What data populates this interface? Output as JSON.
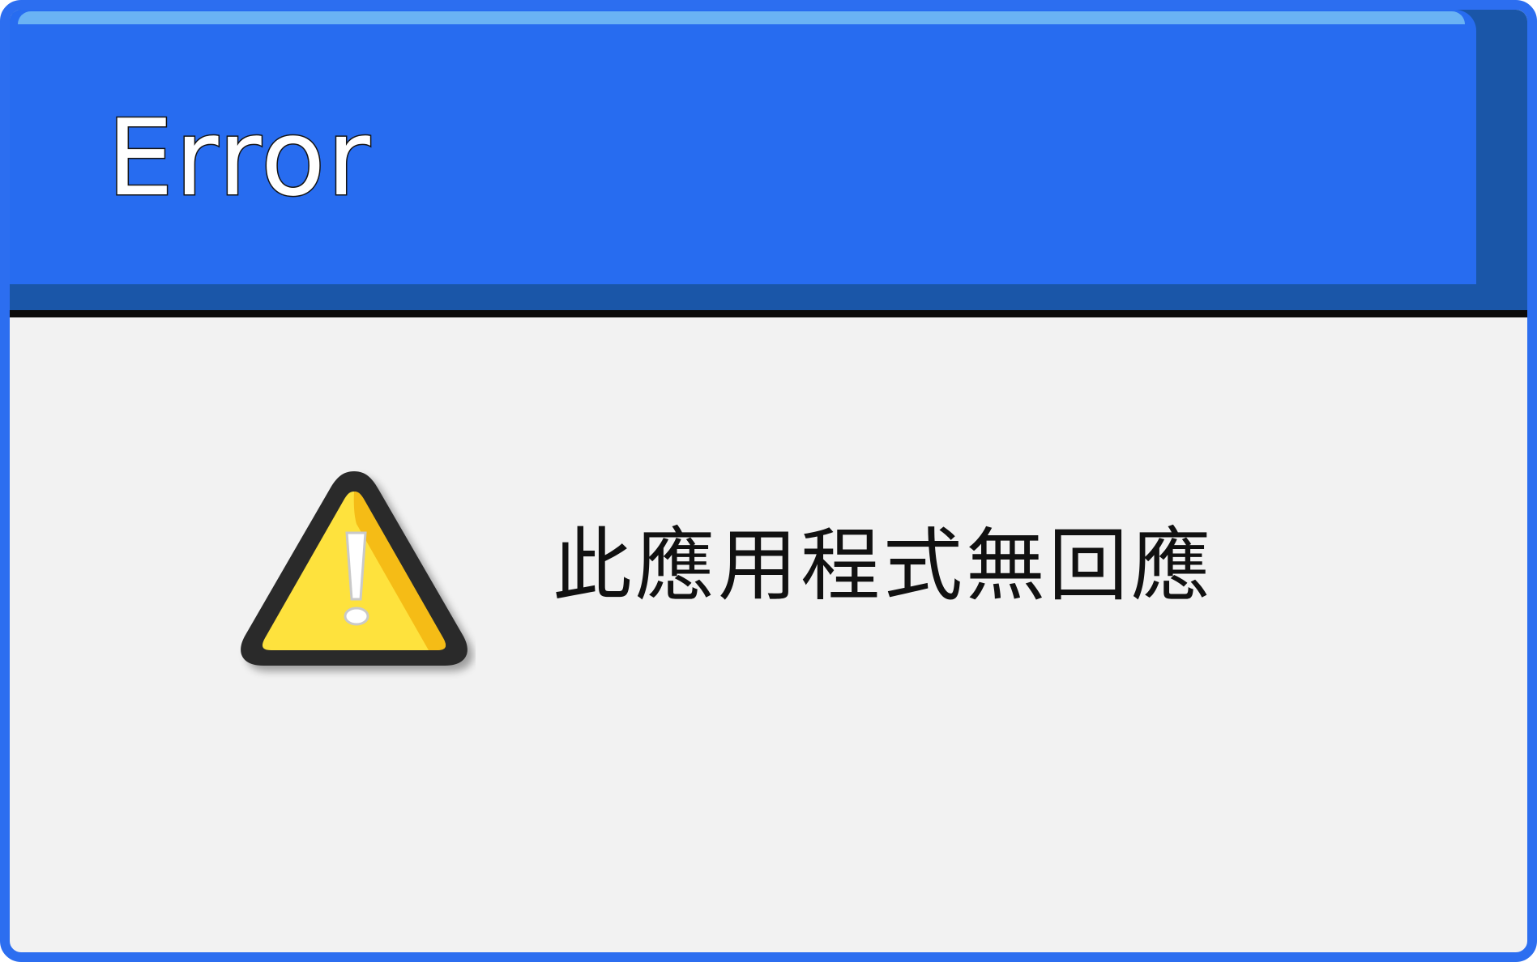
{
  "window": {
    "title": "Error"
  },
  "dialog": {
    "icon": "warning-triangle-icon",
    "message": "此應用程式無回應"
  },
  "colors": {
    "titlebar": "#276cf0",
    "titlebar_shadow": "#1a56a8",
    "titlebar_highlight": "#6ab3f4",
    "border": "#2c6ef0",
    "body_background": "#f2f2f2",
    "warning_fill": "#fee23e",
    "warning_outline": "#2b2b2b"
  }
}
